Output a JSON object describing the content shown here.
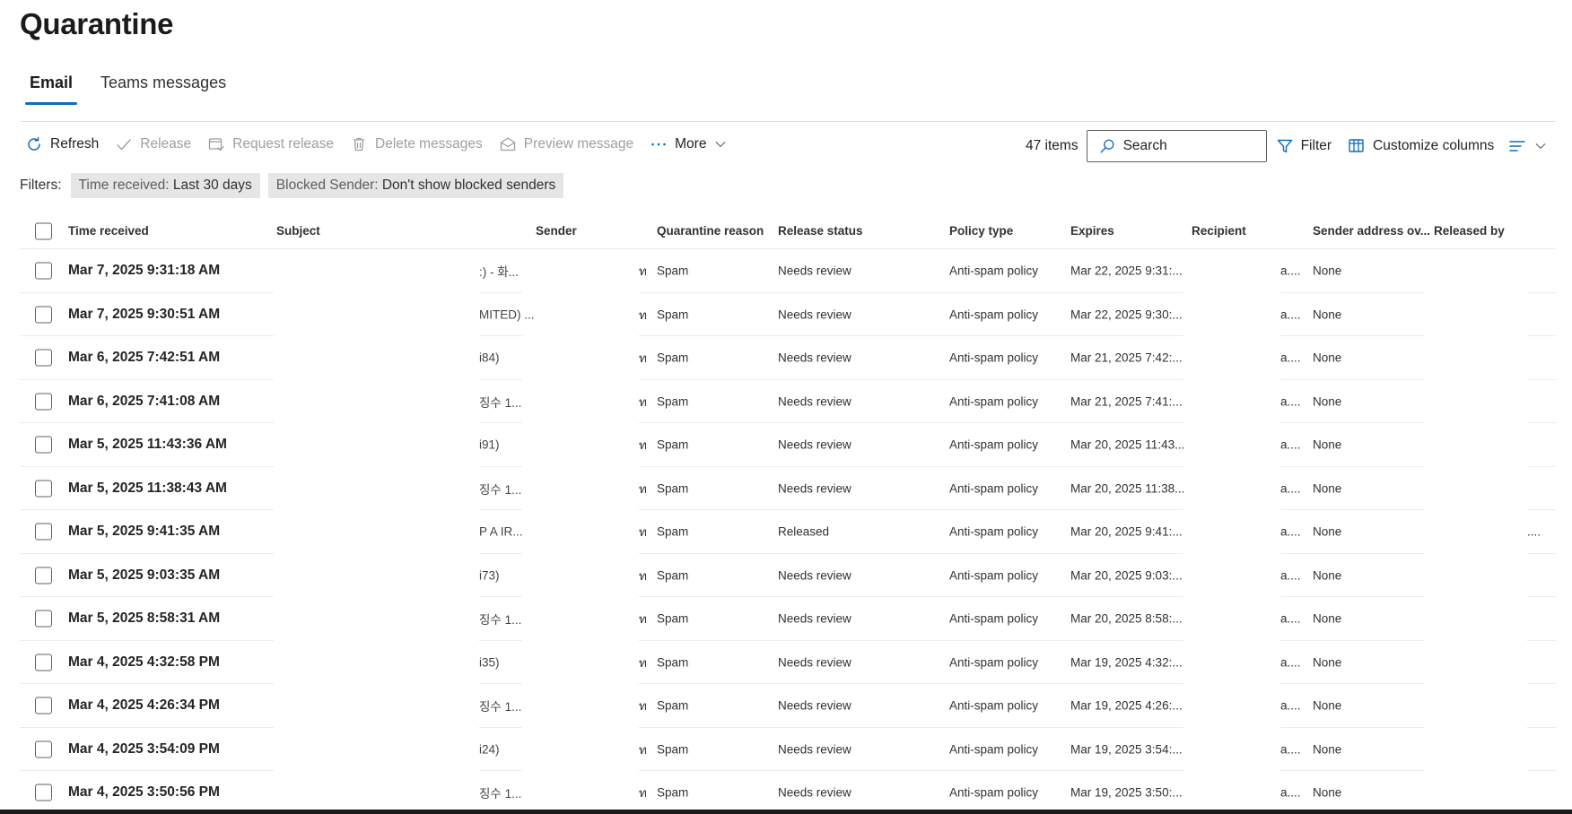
{
  "page": {
    "title": "Quarantine"
  },
  "tabs": [
    {
      "label": "Email",
      "active": true
    },
    {
      "label": "Teams messages",
      "active": false
    }
  ],
  "toolbar": {
    "refresh": "Refresh",
    "release": "Release",
    "request_release": "Request release",
    "delete_messages": "Delete messages",
    "preview_message": "Preview message",
    "more": "More",
    "item_count": "47 items",
    "search_placeholder": "Search",
    "filter": "Filter",
    "customize_columns": "Customize columns"
  },
  "filters": {
    "label": "Filters:",
    "pills": [
      {
        "key": "Time received:",
        "value": "Last 30 days"
      },
      {
        "key": "Blocked Sender:",
        "value": "Don't show blocked senders"
      }
    ]
  },
  "table": {
    "columns": {
      "time_received": "Time received",
      "subject": "Subject",
      "sender": "Sender",
      "quarantine_reason": "Quarantine reason",
      "release_status": "Release status",
      "policy_type": "Policy type",
      "expires": "Expires",
      "recipient": "Recipient",
      "sender_address_override": "Sender address ov...",
      "released_by": "Released by"
    },
    "rows": [
      {
        "time": "Mar 7, 2025 9:31:18 AM",
        "subject": ":) - 화...",
        "sender": "ท",
        "reason": "Spam",
        "status": "Needs review",
        "policy": "Anti-spam policy",
        "expires": "Mar 22, 2025 9:31:...",
        "recipient": "a....",
        "override": "None",
        "released_by": ""
      },
      {
        "time": "Mar 7, 2025 9:30:51 AM",
        "subject": "MITED) ...",
        "sender": "ท",
        "reason": "Spam",
        "status": "Needs review",
        "policy": "Anti-spam policy",
        "expires": "Mar 22, 2025 9:30:...",
        "recipient": "a....",
        "override": "None",
        "released_by": ""
      },
      {
        "time": "Mar 6, 2025 7:42:51 AM",
        "subject": "i84)",
        "sender": "ท",
        "reason": "Spam",
        "status": "Needs review",
        "policy": "Anti-spam policy",
        "expires": "Mar 21, 2025 7:42:...",
        "recipient": "a....",
        "override": "None",
        "released_by": ""
      },
      {
        "time": "Mar 6, 2025 7:41:08 AM",
        "subject": "징수 1...",
        "sender": "ท",
        "reason": "Spam",
        "status": "Needs review",
        "policy": "Anti-spam policy",
        "expires": "Mar 21, 2025 7:41:...",
        "recipient": "a....",
        "override": "None",
        "released_by": ""
      },
      {
        "time": "Mar 5, 2025 11:43:36 AM",
        "subject": "i91)",
        "sender": "ท",
        "reason": "Spam",
        "status": "Needs review",
        "policy": "Anti-spam policy",
        "expires": "Mar 20, 2025 11:43...",
        "recipient": "a....",
        "override": "None",
        "released_by": ""
      },
      {
        "time": "Mar 5, 2025 11:38:43 AM",
        "subject": "징수 1...",
        "sender": "ท",
        "reason": "Spam",
        "status": "Needs review",
        "policy": "Anti-spam policy",
        "expires": "Mar 20, 2025 11:38...",
        "recipient": "a....",
        "override": "None",
        "released_by": ""
      },
      {
        "time": "Mar 5, 2025 9:41:35 AM",
        "subject": "P A IR...",
        "sender": "ท",
        "reason": "Spam",
        "status": "Released",
        "policy": "Anti-spam policy",
        "expires": "Mar 20, 2025 9:41:...",
        "recipient": "a....",
        "override": "None",
        "released_by": "...."
      },
      {
        "time": "Mar 5, 2025 9:03:35 AM",
        "subject": "i73)",
        "sender": "ท",
        "reason": "Spam",
        "status": "Needs review",
        "policy": "Anti-spam policy",
        "expires": "Mar 20, 2025 9:03:...",
        "recipient": "a....",
        "override": "None",
        "released_by": ""
      },
      {
        "time": "Mar 5, 2025 8:58:31 AM",
        "subject": "징수 1...",
        "sender": "ท",
        "reason": "Spam",
        "status": "Needs review",
        "policy": "Anti-spam policy",
        "expires": "Mar 20, 2025 8:58:...",
        "recipient": "a....",
        "override": "None",
        "released_by": ""
      },
      {
        "time": "Mar 4, 2025 4:32:58 PM",
        "subject": "i35)",
        "sender": "ท",
        "reason": "Spam",
        "status": "Needs review",
        "policy": "Anti-spam policy",
        "expires": "Mar 19, 2025 4:32:...",
        "recipient": "a....",
        "override": "None",
        "released_by": ""
      },
      {
        "time": "Mar 4, 2025 4:26:34 PM",
        "subject": "징수 1...",
        "sender": "ท",
        "reason": "Spam",
        "status": "Needs review",
        "policy": "Anti-spam policy",
        "expires": "Mar 19, 2025 4:26:...",
        "recipient": "a....",
        "override": "None",
        "released_by": ""
      },
      {
        "time": "Mar 4, 2025 3:54:09 PM",
        "subject": "i24)",
        "sender": "ท",
        "reason": "Spam",
        "status": "Needs review",
        "policy": "Anti-spam policy",
        "expires": "Mar 19, 2025 3:54:...",
        "recipient": "a....",
        "override": "None",
        "released_by": ""
      },
      {
        "time": "Mar 4, 2025 3:50:56 PM",
        "subject": "징수 1...",
        "sender": "ท",
        "reason": "Spam",
        "status": "Needs review",
        "policy": "Anti-spam policy",
        "expires": "Mar 19, 2025 3:50:...",
        "recipient": "a....",
        "override": "None",
        "released_by": ""
      }
    ]
  },
  "colors": {
    "accent": "#0f6cbd",
    "pill_bg": "#e6e6e6",
    "disabled_text": "#a19f9d"
  },
  "icons": [
    "refresh-icon",
    "checkmark-icon",
    "request-release-icon",
    "trash-icon",
    "preview-icon",
    "more-dots-icon",
    "chevron-down-icon",
    "search-icon",
    "filter-icon",
    "customize-columns-icon",
    "group-list-icon"
  ]
}
